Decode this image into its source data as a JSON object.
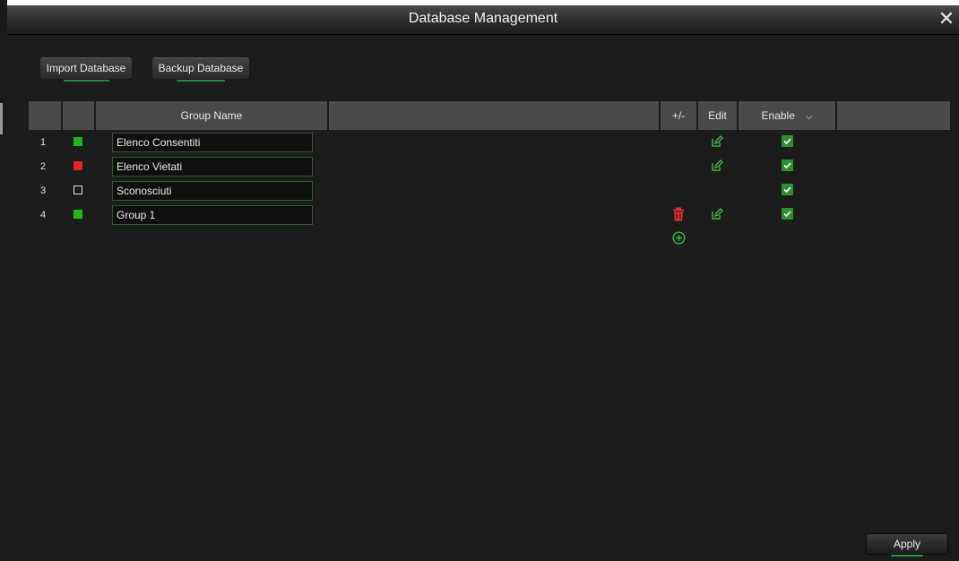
{
  "window": {
    "title": "Database Management"
  },
  "toolbar": {
    "import_label": "Import Database",
    "backup_label": "Backup Database"
  },
  "table": {
    "columns": {
      "group_name": "Group Name",
      "plus_minus": "+/-",
      "edit": "Edit",
      "enable": "Enable"
    },
    "rows": [
      {
        "index": "1",
        "name": "Elenco Consentiti",
        "color": "#22b422",
        "editable": true,
        "deletable": false,
        "enabled": true
      },
      {
        "index": "2",
        "name": "Elenco Vietati",
        "color": "#e02424",
        "editable": true,
        "deletable": false,
        "enabled": true
      },
      {
        "index": "3",
        "name": "Sconosciuti",
        "color": "none",
        "editable": false,
        "deletable": false,
        "enabled": true
      },
      {
        "index": "4",
        "name": "Group 1",
        "color": "#22b422",
        "editable": true,
        "deletable": true,
        "enabled": true
      }
    ]
  },
  "footer": {
    "apply_label": "Apply"
  },
  "colors": {
    "accent_green": "#2f8f2f",
    "delete_red": "#e03030",
    "edit_green": "#4caf50"
  }
}
